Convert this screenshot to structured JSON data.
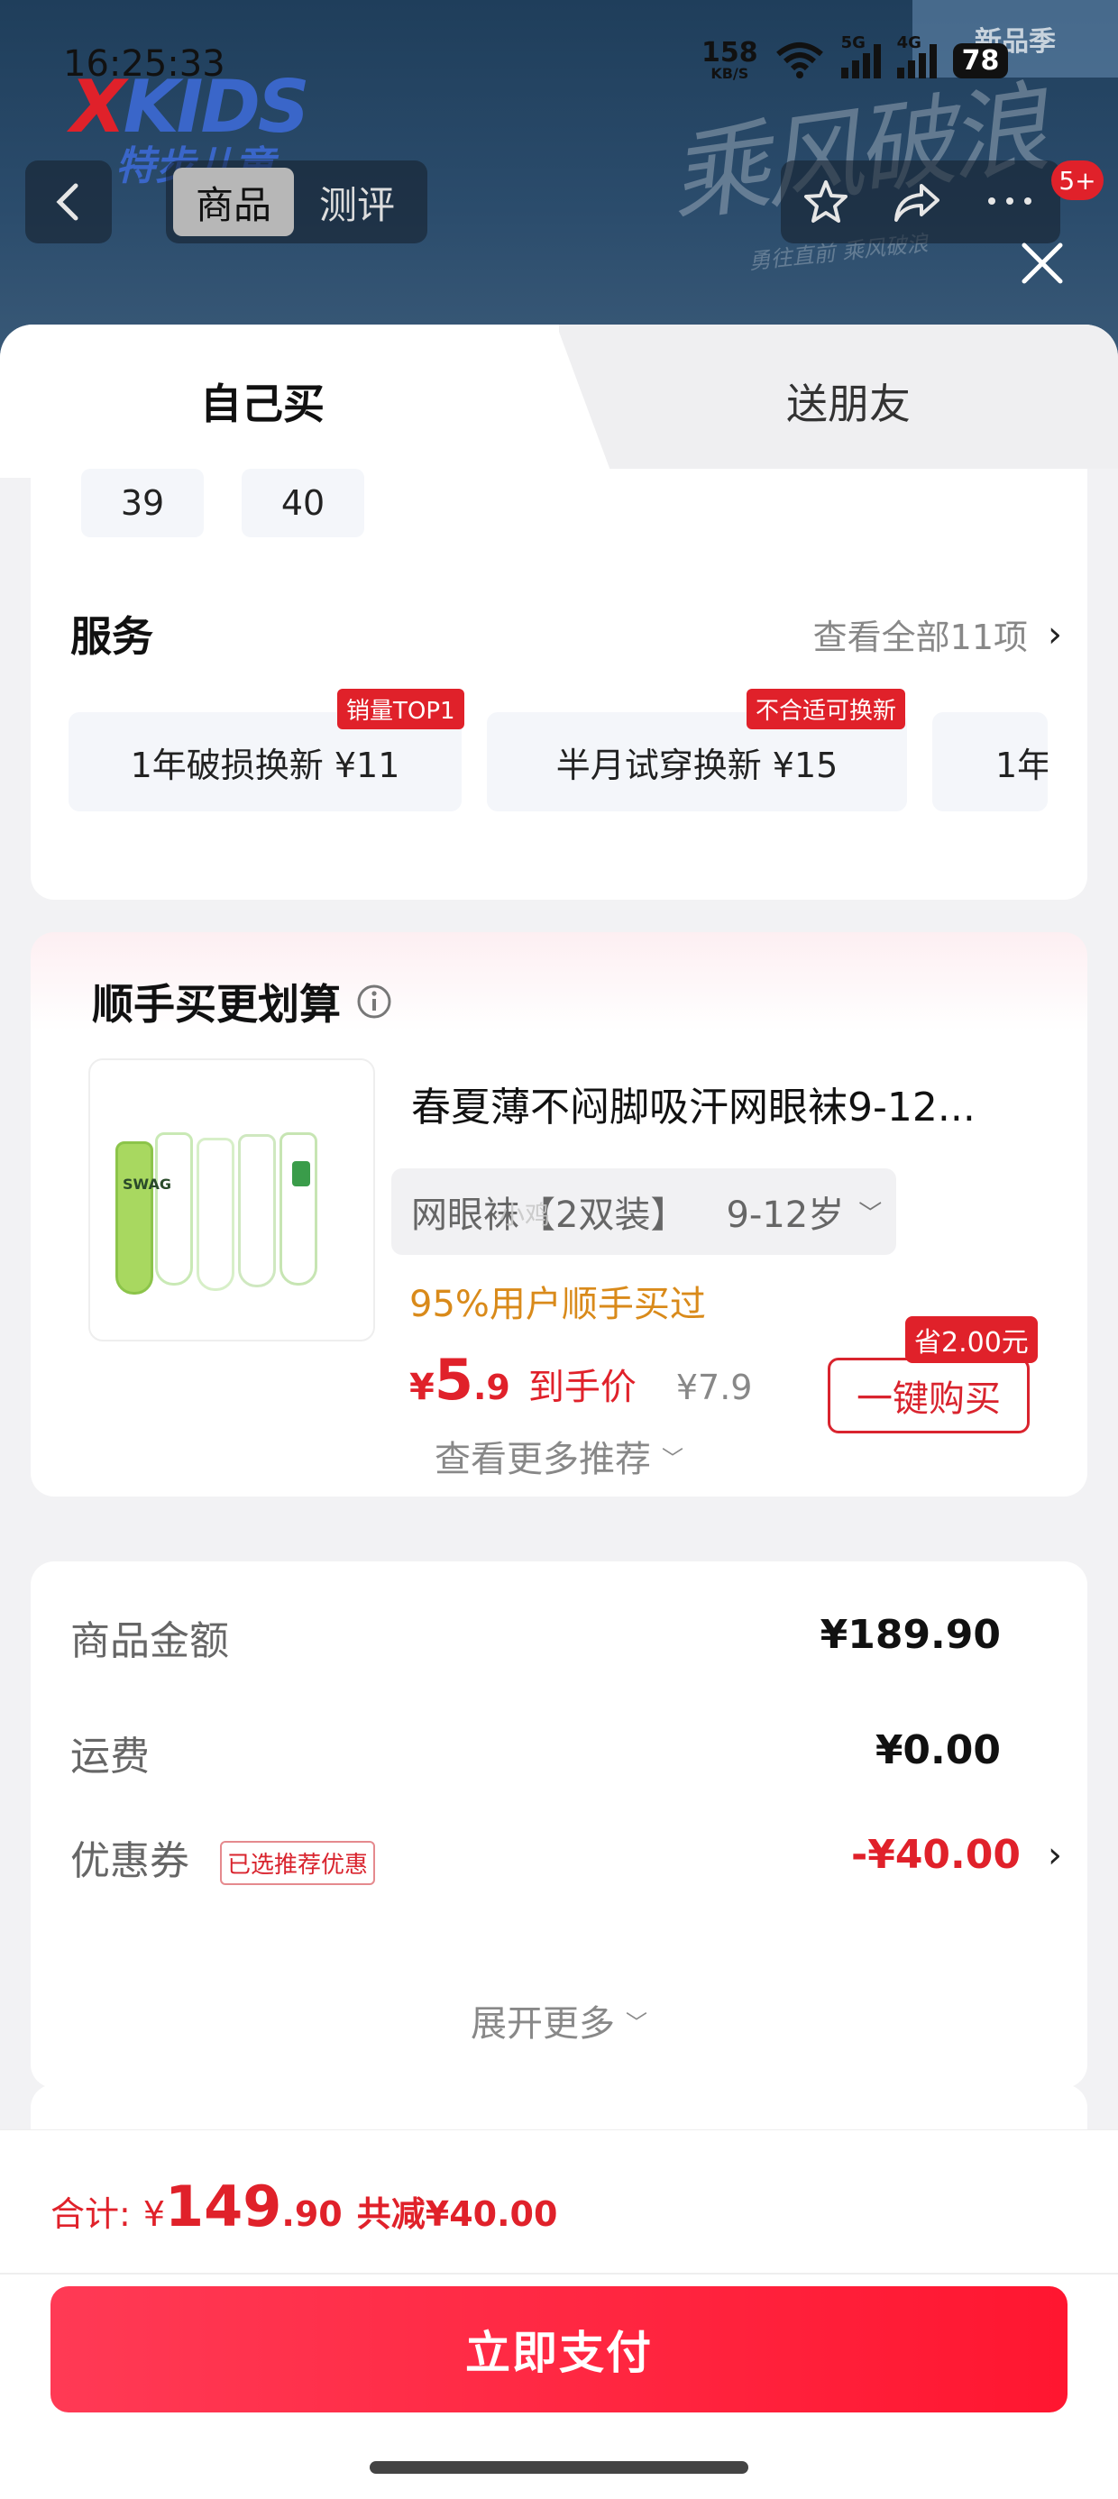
{
  "status_bar": {
    "time": "16:25:33",
    "speed_value": "158",
    "speed_unit": "KB/S",
    "net1": "5G",
    "net2": "4G",
    "battery": "78"
  },
  "header": {
    "brand": "XKIDS",
    "brand_sub": "特步儿童",
    "banner_text": "乘风破浪",
    "banner_sub": "勇往直前 乘风破浪",
    "corner_label": "新品季",
    "tabs": [
      "商品",
      "测评"
    ],
    "active_tab": "商品",
    "cart_badge": "5+",
    "icons": [
      "back-icon",
      "star-icon",
      "share-icon",
      "more-icon",
      "close-icon"
    ]
  },
  "sheet": {
    "tabs": [
      "自己买",
      "送朋友"
    ],
    "active_tab": "自己买"
  },
  "sizes": [
    "39",
    "40"
  ],
  "services": {
    "title": "服务",
    "view_all": "查看全部11项",
    "items": [
      {
        "label": "1年破损换新  ¥11",
        "tag": "销量TOP1"
      },
      {
        "label": "半月试穿换新  ¥15",
        "tag": "不合适可换新"
      },
      {
        "label": "1年",
        "tag": ""
      }
    ]
  },
  "bundle": {
    "title": "顺手买更划算",
    "product_title": "春夏薄不闷脚吸汗网眼袜9-12...",
    "variant": "网眼袜【2双装】",
    "variant_age": "9-12岁",
    "social_proof": "95%用户顺手买过",
    "currency": "¥",
    "price_int": "5",
    "price_dec": ".9",
    "price_label": "到手价",
    "original_price": "¥7.9",
    "save_badge": "省2.00元",
    "buy_button": "一键购买",
    "more": "查看更多推荐",
    "watermark": "小鸡"
  },
  "summary": {
    "rows": [
      {
        "label": "商品金额",
        "value": "¥189.90"
      },
      {
        "label": "运费",
        "value": "¥0.00"
      },
      {
        "label": "优惠券",
        "value": "-¥40.00",
        "tag": "已选推荐优惠"
      }
    ],
    "expand": "展开更多"
  },
  "footer": {
    "total_label": "合计:",
    "currency": "¥",
    "total_int": "149",
    "total_dec": ".90",
    "discount": "共减¥40.00",
    "pay_button": "立即支付"
  },
  "colors": {
    "accent_red": "#e0212a",
    "orange_text": "#d98a1a",
    "header_bg": "#2b4c6c"
  }
}
